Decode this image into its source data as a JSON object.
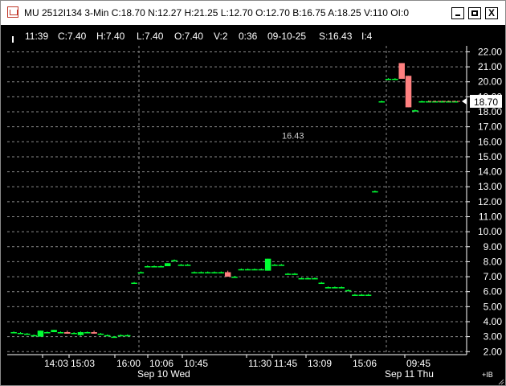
{
  "window": {
    "title": "MU 2512I134 3-Min C:18.70 N:12.27 H:21.25 L:12.70 O:12.70 B:16.75 A:18.25 V:110 OI:0",
    "minimize_label": "_",
    "maximize_label": "□",
    "close_label": "X"
  },
  "info_bar": {
    "time": "11:39",
    "close": "C:7.40",
    "high": "H:7.40",
    "low": "L:7.40",
    "open": "O:7.40",
    "volume": "V:2",
    "elapsed": "0:36",
    "date": "09-10-25",
    "strike": "S:16.43",
    "interval": "I:4"
  },
  "colors": {
    "background": "#000000",
    "up": "#00ff33",
    "down": "#ff8080",
    "grid": "#8a8a8a",
    "axis_text": "#ffffff",
    "price_line": "#ff6b6b"
  },
  "chart_data": {
    "type": "candlestick",
    "title": "",
    "xlabel": "",
    "ylabel": "",
    "ylim": [
      1.8,
      22.4
    ],
    "y_ticks": [
      "22.00",
      "21.00",
      "20.00",
      "19.00",
      "18.00",
      "17.00",
      "16.00",
      "15.00",
      "14.00",
      "13.00",
      "12.00",
      "11.00",
      "10.00",
      "9.00",
      "8.00",
      "7.00",
      "6.00",
      "5.00",
      "4.00",
      "3.00",
      "2.00"
    ],
    "x_tick_labels": [
      "14:03",
      "15:03",
      "16:00",
      "10:06",
      "10:45",
      "11:30",
      "11:45",
      "13:09",
      "15:06",
      "09:45"
    ],
    "session_labels": [
      "Sep 10 Wed",
      "Sep 11 Thu"
    ],
    "last_price_label": "18.70",
    "strike_label": "16.43",
    "strike_value": 16.43,
    "footer_label": "+IB",
    "candles": [
      {
        "o": 3.3,
        "h": 3.35,
        "l": 3.25,
        "c": 3.3
      },
      {
        "o": 3.25,
        "h": 3.3,
        "l": 3.2,
        "c": 3.25
      },
      {
        "o": 3.2,
        "h": 3.25,
        "l": 3.15,
        "c": 3.2
      },
      {
        "o": 3.1,
        "h": 3.15,
        "l": 3.05,
        "c": 3.1
      },
      {
        "o": 3.0,
        "h": 3.4,
        "l": 3.0,
        "c": 3.4
      },
      {
        "o": 3.3,
        "h": 3.35,
        "l": 3.25,
        "c": 3.3
      },
      {
        "o": 3.3,
        "h": 3.45,
        "l": 3.3,
        "c": 3.45
      },
      {
        "o": 3.3,
        "h": 3.35,
        "l": 3.25,
        "c": 3.3
      },
      {
        "o": 3.3,
        "h": 3.4,
        "l": 3.2,
        "c": 3.2
      },
      {
        "o": 3.25,
        "h": 3.3,
        "l": 3.2,
        "c": 3.25
      },
      {
        "o": 3.1,
        "h": 3.35,
        "l": 3.05,
        "c": 3.3
      },
      {
        "o": 3.3,
        "h": 3.35,
        "l": 3.25,
        "c": 3.3
      },
      {
        "o": 3.3,
        "h": 3.4,
        "l": 3.2,
        "c": 3.2
      },
      {
        "o": 3.2,
        "h": 3.25,
        "l": 3.15,
        "c": 3.2
      },
      {
        "o": 3.1,
        "h": 3.15,
        "l": 3.05,
        "c": 3.1
      },
      {
        "o": 3.0,
        "h": 3.05,
        "l": 2.95,
        "c": 3.0
      },
      {
        "o": 3.1,
        "h": 3.15,
        "l": 3.05,
        "c": 3.1
      },
      {
        "o": 3.1,
        "h": 3.15,
        "l": 3.05,
        "c": 3.1
      },
      {
        "o": 6.6,
        "h": 6.65,
        "l": 6.55,
        "c": 6.6
      },
      {
        "o": 7.3,
        "h": 7.35,
        "l": 7.25,
        "c": 7.3
      },
      {
        "o": 7.7,
        "h": 7.75,
        "l": 7.65,
        "c": 7.7
      },
      {
        "o": 7.7,
        "h": 7.75,
        "l": 7.65,
        "c": 7.7
      },
      {
        "o": 7.7,
        "h": 7.75,
        "l": 7.65,
        "c": 7.7
      },
      {
        "o": 7.7,
        "h": 7.9,
        "l": 7.7,
        "c": 7.9
      },
      {
        "o": 8.1,
        "h": 8.15,
        "l": 8.05,
        "c": 8.1
      },
      {
        "o": 7.8,
        "h": 7.85,
        "l": 7.75,
        "c": 7.8
      },
      {
        "o": 7.8,
        "h": 7.85,
        "l": 7.75,
        "c": 7.8
      },
      {
        "o": 7.3,
        "h": 7.35,
        "l": 7.25,
        "c": 7.3
      },
      {
        "o": 7.3,
        "h": 7.35,
        "l": 7.25,
        "c": 7.3
      },
      {
        "o": 7.3,
        "h": 7.35,
        "l": 7.25,
        "c": 7.3
      },
      {
        "o": 7.3,
        "h": 7.35,
        "l": 7.25,
        "c": 7.3
      },
      {
        "o": 7.3,
        "h": 7.35,
        "l": 7.25,
        "c": 7.3
      },
      {
        "o": 7.3,
        "h": 7.4,
        "l": 7.0,
        "c": 7.0
      },
      {
        "o": 7.0,
        "h": 7.05,
        "l": 6.95,
        "c": 7.0
      },
      {
        "o": 7.5,
        "h": 7.55,
        "l": 7.45,
        "c": 7.5
      },
      {
        "o": 7.5,
        "h": 7.55,
        "l": 7.45,
        "c": 7.5
      },
      {
        "o": 7.5,
        "h": 7.55,
        "l": 7.45,
        "c": 7.5
      },
      {
        "o": 7.5,
        "h": 7.55,
        "l": 7.45,
        "c": 7.5
      },
      {
        "o": 7.4,
        "h": 8.2,
        "l": 7.4,
        "c": 8.2
      },
      {
        "o": 7.8,
        "h": 7.85,
        "l": 7.75,
        "c": 7.8
      },
      {
        "o": 7.8,
        "h": 7.85,
        "l": 7.75,
        "c": 7.8
      },
      {
        "o": 7.2,
        "h": 7.25,
        "l": 7.15,
        "c": 7.2
      },
      {
        "o": 7.2,
        "h": 7.25,
        "l": 7.15,
        "c": 7.2
      },
      {
        "o": 6.9,
        "h": 6.95,
        "l": 6.85,
        "c": 6.9
      },
      {
        "o": 6.9,
        "h": 6.95,
        "l": 6.85,
        "c": 6.9
      },
      {
        "o": 6.9,
        "h": 6.95,
        "l": 6.85,
        "c": 6.9
      },
      {
        "o": 6.6,
        "h": 6.65,
        "l": 6.55,
        "c": 6.6
      },
      {
        "o": 6.3,
        "h": 6.35,
        "l": 6.25,
        "c": 6.3
      },
      {
        "o": 6.3,
        "h": 6.35,
        "l": 6.25,
        "c": 6.3
      },
      {
        "o": 6.3,
        "h": 6.35,
        "l": 6.25,
        "c": 6.3
      },
      {
        "o": 6.1,
        "h": 6.15,
        "l": 6.05,
        "c": 6.1
      },
      {
        "o": 5.8,
        "h": 5.85,
        "l": 5.75,
        "c": 5.8
      },
      {
        "o": 5.8,
        "h": 5.85,
        "l": 5.75,
        "c": 5.8
      },
      {
        "o": 5.8,
        "h": 5.85,
        "l": 5.75,
        "c": 5.8
      },
      {
        "o": 12.7,
        "h": 12.75,
        "l": 12.65,
        "c": 12.7
      },
      {
        "o": 18.7,
        "h": 18.75,
        "l": 18.65,
        "c": 18.7
      },
      {
        "o": 20.2,
        "h": 20.25,
        "l": 20.15,
        "c": 20.2
      },
      {
        "o": 20.2,
        "h": 20.25,
        "l": 20.15,
        "c": 20.2
      },
      {
        "o": 21.25,
        "h": 21.25,
        "l": 20.2,
        "c": 20.2
      },
      {
        "o": 20.4,
        "h": 20.4,
        "l": 18.3,
        "c": 18.3
      },
      {
        "o": 18.1,
        "h": 18.15,
        "l": 18.05,
        "c": 18.1
      },
      {
        "o": 18.7,
        "h": 18.75,
        "l": 18.65,
        "c": 18.7
      },
      {
        "o": 18.7,
        "h": 18.75,
        "l": 18.65,
        "c": 18.7
      },
      {
        "o": 18.7,
        "h": 18.75,
        "l": 18.65,
        "c": 18.7
      },
      {
        "o": 18.7,
        "h": 18.75,
        "l": 18.65,
        "c": 18.7
      },
      {
        "o": 18.7,
        "h": 18.75,
        "l": 18.65,
        "c": 18.7
      },
      {
        "o": 18.7,
        "h": 18.75,
        "l": 18.65,
        "c": 18.7
      }
    ]
  }
}
